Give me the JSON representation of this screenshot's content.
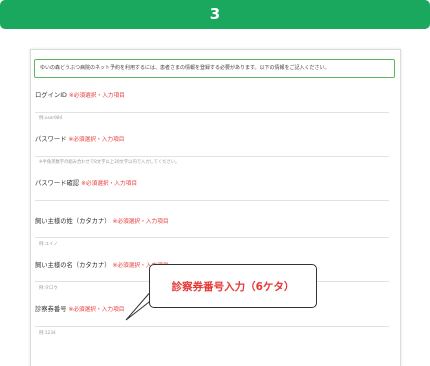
{
  "step": {
    "number": "3"
  },
  "notice": "ゆいの森どうぶつ病院のネット予約を利用するには、患者さまの情報を登録する必要があります。以下の情報をご記入ください。",
  "required_label": "※必須選択・入力項目",
  "fields": [
    {
      "label": "ログインID",
      "hint": "例:user984"
    },
    {
      "label": "パスワード",
      "hint": "※半角英数字の組み合わせで8文字以上20文字以内で入力してください。"
    },
    {
      "label": "パスワード確認",
      "hint": ""
    },
    {
      "label": "飼い主様の姓（カタカナ）",
      "hint": "例:ユイノ"
    },
    {
      "label": "飼い主様の名（カタカナ）",
      "hint": "例:タロウ"
    },
    {
      "label": "診察券番号",
      "hint": "例:1234"
    }
  ],
  "callout": "診察券番号入力（6ケタ）",
  "colors": {
    "header_green": "#1aa85f",
    "required_red": "#e63b3b",
    "callout_red": "#e53935",
    "notice_border": "#5cb85c"
  }
}
